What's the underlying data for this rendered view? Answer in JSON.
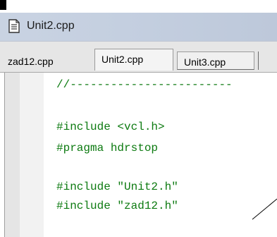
{
  "window": {
    "title": "Unit2.cpp",
    "title_icon": "document-icon"
  },
  "tabs": [
    {
      "label": "zad12.cpp",
      "active": false
    },
    {
      "label": "Unit2.cpp",
      "active": true
    },
    {
      "label": "Unit3.cpp",
      "active": false
    }
  ],
  "editor": {
    "lines": [
      "//------------------------",
      "",
      "#include <vcl.h>",
      "#pragma hdrstop",
      "",
      "#include \"Unit2.h\"",
      "#include \"zad12.h\""
    ]
  },
  "colors": {
    "code_text": "#0c7a10",
    "title_bar": "#c9d3e2",
    "tab_bar": "#e6e6e6"
  }
}
